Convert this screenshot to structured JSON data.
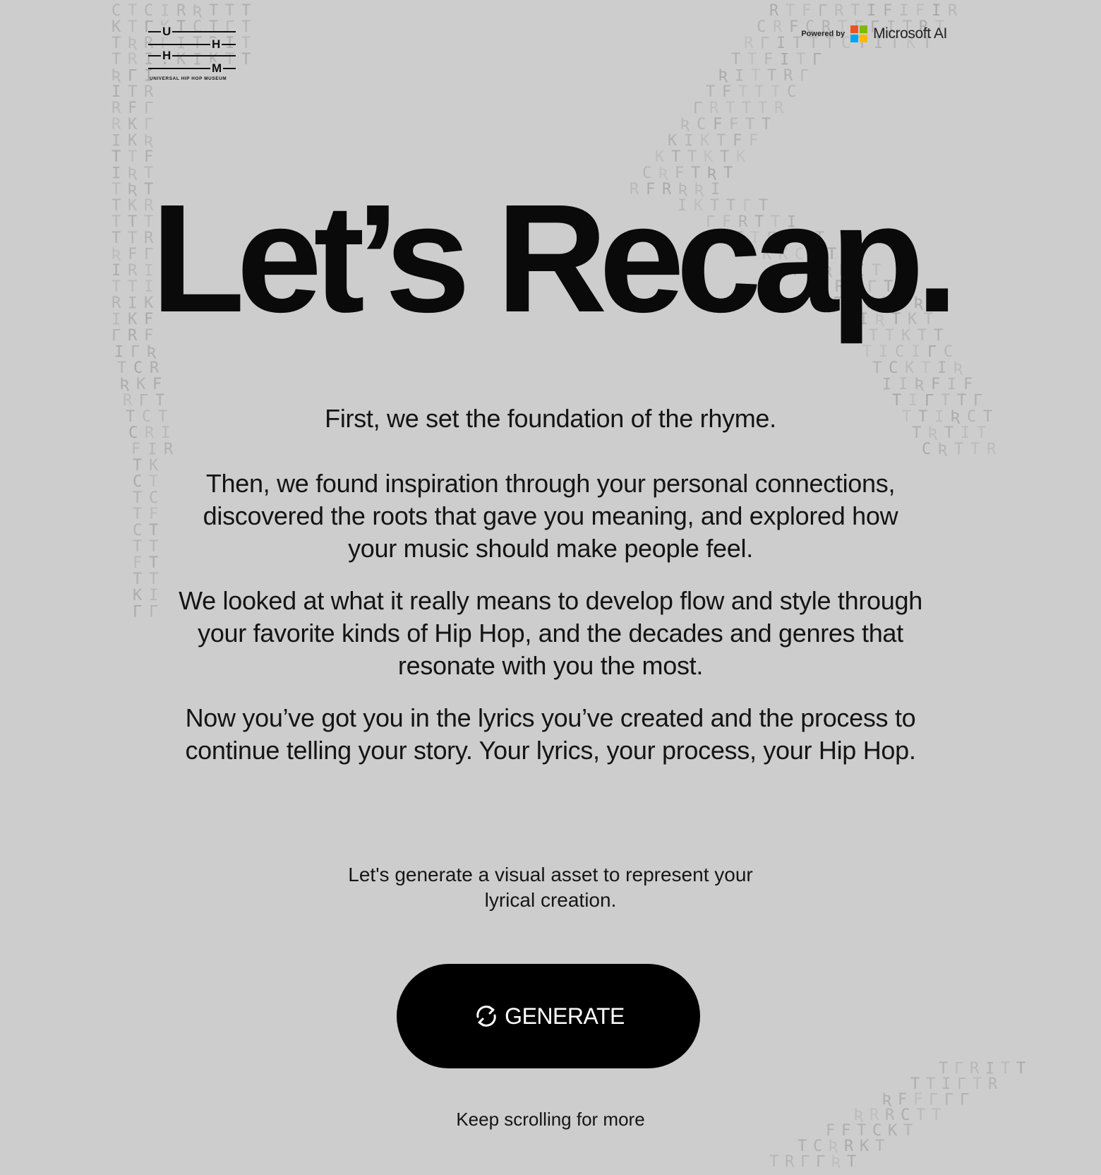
{
  "header": {
    "logo": {
      "letters": [
        "U",
        "H",
        "H",
        "M"
      ],
      "caption": "UNIVERSAL HIP HOP MUSEUM"
    },
    "powered_by": {
      "label": "Powered by",
      "brand": "Microsoft AI",
      "logo_colors": [
        "#f25022",
        "#7fba00",
        "#00a4ef",
        "#ffb900"
      ]
    }
  },
  "main": {
    "title": "Let’s Recap.",
    "paragraphs": [
      "First, we set the foundation of the rhyme.",
      "Then, we found inspiration through your personal connections, discovered the roots that gave you meaning, and explored how your music should make people feel.",
      "We looked at what it really means to develop flow and style through your favorite kinds of Hip Hop, and the decades and genres that resonate with you the most.",
      "Now you’ve got you in the lyrics you’ve created and the process to continue telling your story. Your lyrics, your process, your Hip Hop."
    ],
    "generate_prompt": "Let's generate a visual asset to represent your lyrical creation.",
    "generate_button": {
      "label": "GENERATE",
      "icon": "refresh-icon"
    },
    "footer_hint": "Keep scrolling for more"
  },
  "colors": {
    "background": "#cdcdcd",
    "text": "#111111",
    "button_bg": "#000000",
    "button_text": "#ffffff",
    "background_glyphs": "#a8a8a8"
  }
}
